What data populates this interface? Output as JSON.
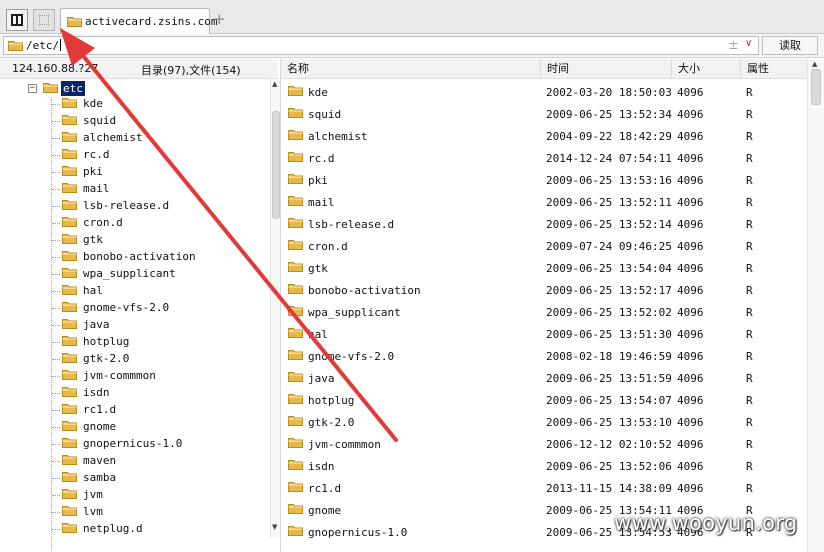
{
  "tab": {
    "title": "activecard.zsins.com",
    "add_label": "+"
  },
  "address": {
    "path": "/etc/",
    "add_label": "±",
    "dropdown_label": "∨",
    "read_button": "读取"
  },
  "left_header": {
    "ip": "124.160.88.?27",
    "counts": "目录(97),文件(154)"
  },
  "tree": {
    "root": {
      "toggle": "−",
      "label": "etc"
    },
    "items": [
      "kde",
      "squid",
      "alchemist",
      "rc.d",
      "pki",
      "mail",
      "lsb-release.d",
      "cron.d",
      "gtk",
      "bonobo-activation",
      "wpa_supplicant",
      "hal",
      "gnome-vfs-2.0",
      "java",
      "hotplug",
      "gtk-2.0",
      "jvm-commmon",
      "isdn",
      "rc1.d",
      "gnome",
      "gnopernicus-1.0",
      "maven",
      "samba",
      "jvm",
      "lvm",
      "netplug.d"
    ]
  },
  "columns": {
    "name": "名称",
    "time": "时间",
    "size": "大小",
    "attr": "属性"
  },
  "rows": [
    {
      "name": "kde",
      "time": "2002-03-20 18:50:03",
      "size": "4096",
      "attr": "R"
    },
    {
      "name": "squid",
      "time": "2009-06-25 13:52:34",
      "size": "4096",
      "attr": "R"
    },
    {
      "name": "alchemist",
      "time": "2004-09-22 18:42:29",
      "size": "4096",
      "attr": "R"
    },
    {
      "name": "rc.d",
      "time": "2014-12-24 07:54:11",
      "size": "4096",
      "attr": "R"
    },
    {
      "name": "pki",
      "time": "2009-06-25 13:53:16",
      "size": "4096",
      "attr": "R"
    },
    {
      "name": "mail",
      "time": "2009-06-25 13:52:11",
      "size": "4096",
      "attr": "R"
    },
    {
      "name": "lsb-release.d",
      "time": "2009-06-25 13:52:14",
      "size": "4096",
      "attr": "R"
    },
    {
      "name": "cron.d",
      "time": "2009-07-24 09:46:25",
      "size": "4096",
      "attr": "R"
    },
    {
      "name": "gtk",
      "time": "2009-06-25 13:54:04",
      "size": "4096",
      "attr": "R"
    },
    {
      "name": "bonobo-activation",
      "time": "2009-06-25 13:52:17",
      "size": "4096",
      "attr": "R"
    },
    {
      "name": "wpa_supplicant",
      "time": "2009-06-25 13:52:02",
      "size": "4096",
      "attr": "R"
    },
    {
      "name": "hal",
      "time": "2009-06-25 13:51:30",
      "size": "4096",
      "attr": "R"
    },
    {
      "name": "gnome-vfs-2.0",
      "time": "2008-02-18 19:46:59",
      "size": "4096",
      "attr": "R"
    },
    {
      "name": "java",
      "time": "2009-06-25 13:51:59",
      "size": "4096",
      "attr": "R"
    },
    {
      "name": "hotplug",
      "time": "2009-06-25 13:54:07",
      "size": "4096",
      "attr": "R"
    },
    {
      "name": "gtk-2.0",
      "time": "2009-06-25 13:53:10",
      "size": "4096",
      "attr": "R"
    },
    {
      "name": "jvm-commmon",
      "time": "2006-12-12 02:10:52",
      "size": "4096",
      "attr": "R"
    },
    {
      "name": "isdn",
      "time": "2009-06-25 13:52:06",
      "size": "4096",
      "attr": "R"
    },
    {
      "name": "rc1.d",
      "time": "2013-11-15 14:38:09",
      "size": "4096",
      "attr": "R"
    },
    {
      "name": "gnome",
      "time": "2009-06-25 13:54:11",
      "size": "4096",
      "attr": "R"
    },
    {
      "name": "gnopernicus-1.0",
      "time": "2009-06-25 13:54:53",
      "size": "4096",
      "attr": "R"
    }
  ],
  "watermark": "www.wooyun.org",
  "colors": {
    "folder": "#e8b84a",
    "folder_dark": "#b98a1c",
    "selection": "#0a246a",
    "arrow": "#e23a3a"
  }
}
